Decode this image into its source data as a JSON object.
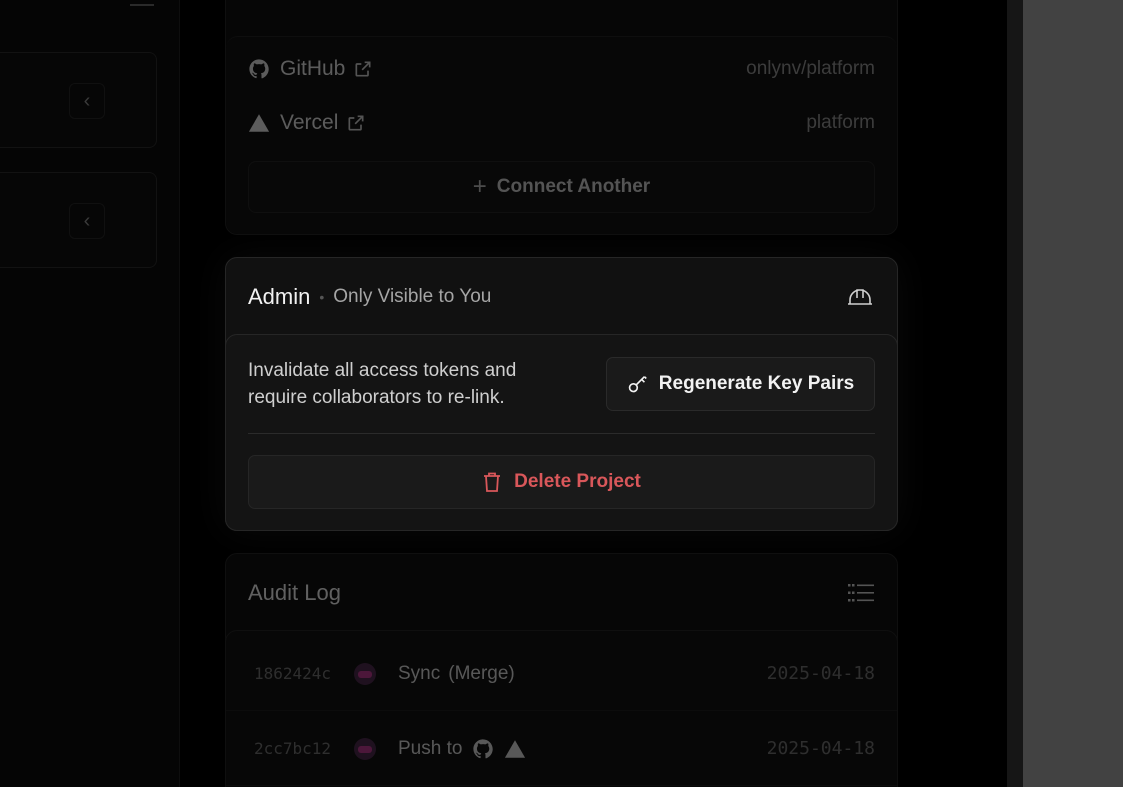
{
  "integrations": {
    "items": [
      {
        "name": "GitHub",
        "icon": "github-icon",
        "value": "onlynv/platform"
      },
      {
        "name": "Vercel",
        "icon": "vercel-triangle-icon",
        "value": "platform"
      }
    ],
    "connect_label": "Connect Another"
  },
  "admin": {
    "title": "Admin",
    "subtitle": "Only Visible to You",
    "description_line1": "Invalidate all access tokens and",
    "description_line2": "require collaborators to re-link.",
    "regenerate_label": "Regenerate Key Pairs",
    "delete_label": "Delete Project",
    "danger_color": "#d9575a"
  },
  "audit": {
    "title": "Audit Log",
    "rows": [
      {
        "hash": "1862424c",
        "message": "Sync",
        "detail": "(Merge)",
        "date": "2025-04-18"
      },
      {
        "hash": "2cc7bc12",
        "message": "Push to",
        "detail": "",
        "date": "2025-04-18"
      }
    ]
  }
}
